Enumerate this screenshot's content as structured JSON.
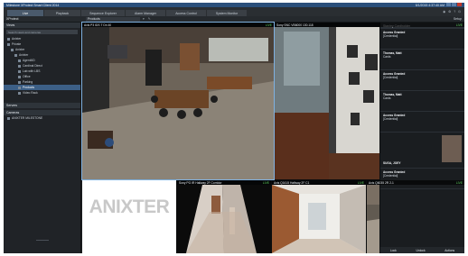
{
  "window": {
    "title": "Milestone XProtect Smart Client 2014",
    "datetime": "5/1/2015 4:37:40 AM"
  },
  "tabs": [
    {
      "label": "Live",
      "active": true
    },
    {
      "label": "Playback",
      "active": false
    },
    {
      "label": "Sequence Explorer",
      "active": false
    },
    {
      "label": "Alarm Manager",
      "active": false
    },
    {
      "label": "Access Control",
      "active": false
    },
    {
      "label": "System Monitor",
      "active": false
    }
  ],
  "toolbar": {
    "views_label": "XProtect",
    "view_select": "Products",
    "setup_label": "Setup"
  },
  "sidebar": {
    "views_header": "Views",
    "search_placeholder": "Search views and cameras",
    "tree": [
      {
        "label": "Anixter",
        "indent": 1,
        "selected": false
      },
      {
        "label": "Private",
        "indent": 1,
        "selected": false
      },
      {
        "label": "Anixter",
        "indent": 2,
        "selected": false
      },
      {
        "label": "Anixter",
        "indent": 3,
        "selected": false
      },
      {
        "label": "Agent4ID",
        "indent": 4,
        "selected": false
      },
      {
        "label": "Cardinal Direct",
        "indent": 4,
        "selected": false
      },
      {
        "label": "Lab with LBS",
        "indent": 4,
        "selected": false
      },
      {
        "label": "Office",
        "indent": 4,
        "selected": false
      },
      {
        "label": "Parking",
        "indent": 4,
        "selected": false
      },
      {
        "label": "Products",
        "indent": 4,
        "selected": true
      },
      {
        "label": "Video Rack",
        "indent": 4,
        "selected": false
      }
    ],
    "servers_header": "Servers",
    "cameras_header": "Cameras",
    "camera_tree": [
      {
        "label": "ANIXTER MILESTONE",
        "indent": 1
      }
    ]
  },
  "cameras": [
    {
      "title": "Axis P3 IDS T Dn 40",
      "status": "LIVE"
    },
    {
      "title": "Sony SNC VB6000 130.118",
      "status": "LIVE"
    },
    {
      "title": "",
      "status": ""
    },
    {
      "title": "Sony PG IR Hallway 2F Corridor",
      "status": "LIVE"
    },
    {
      "title": "Axis Q1615 Hallway 2F C1",
      "status": "LIVE"
    },
    {
      "title": "Axis Q6035 2R 2-1",
      "status": "LIVE"
    }
  ],
  "logo_text": "ANIXTER",
  "right_panel": {
    "header": "Stanley Cardholder",
    "entries": [
      {
        "name": "Access Granted",
        "detail": "[Credential]",
        "has_photo": false
      },
      {
        "name": "Thomas, Matt",
        "detail": "Cards",
        "has_photo": false
      },
      {
        "name": "Access Granted",
        "detail": "[Credential]",
        "has_photo": false
      },
      {
        "name": "Thomas, Matt",
        "detail": "Cards",
        "has_photo": false
      },
      {
        "name": "Access Granted",
        "detail": "[Credential]",
        "has_photo": false
      },
      {
        "name": "SUGA, JOEY",
        "detail": "",
        "has_photo": true
      },
      {
        "name": "Access Granted",
        "detail": "[Credential]",
        "has_photo": false
      }
    ],
    "footer": [
      "Lock",
      "Unlock",
      "Actions"
    ]
  }
}
